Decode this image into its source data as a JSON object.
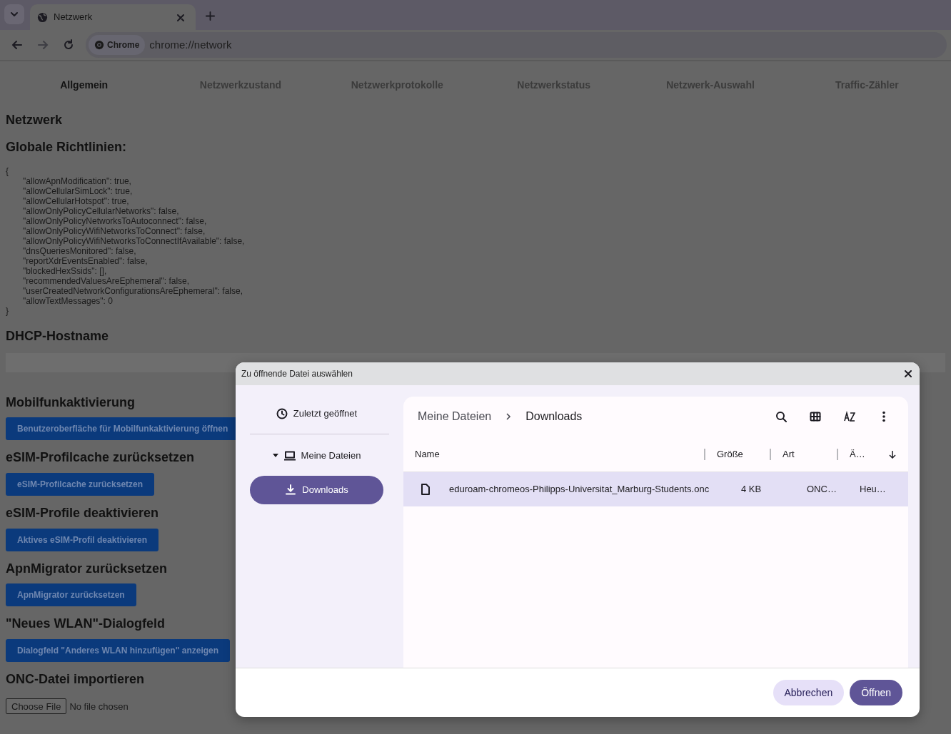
{
  "browser": {
    "tabs": [
      {
        "title": "Netzwerk",
        "selected": true
      }
    ],
    "site_chip": "Chrome",
    "url": "chrome://network"
  },
  "page_tabs": [
    {
      "label": "Allgemein",
      "selected": true
    },
    {
      "label": "Netzwerkzustand",
      "selected": false
    },
    {
      "label": "Netzwerkprotokolle",
      "selected": false
    },
    {
      "label": "Netzwerkstatus",
      "selected": false
    },
    {
      "label": "Netzwerk-Auswahl",
      "selected": false
    },
    {
      "label": "Traffic-Zähler",
      "selected": false
    }
  ],
  "title": "Netzwerk",
  "policies": {
    "heading": "Globale Richtlinien:",
    "open": "{",
    "lines": [
      "\"allowApnModification\": true,",
      "\"allowCellularSimLock\": true,",
      "\"allowCellularHotspot\": true,",
      "\"allowOnlyPolicyCellularNetworks\": false,",
      "\"allowOnlyPolicyNetworksToAutoconnect\": false,",
      "\"allowOnlyPolicyWifiNetworksToConnect\": false,",
      "\"allowOnlyPolicyWifiNetworksToConnectIfAvailable\": false,",
      "\"dnsQueriesMonitored\": false,",
      "\"reportXdrEventsEnabled\": false,",
      "\"blockedHexSsids\": [],",
      "\"recommendedValuesAreEphemeral\": false,",
      "\"userCreatedNetworkConfigurationsAreEphemeral\": false,",
      "\"allowTextMessages\": 0"
    ],
    "close": "}"
  },
  "sections": [
    {
      "heading": "DHCP-Hostname",
      "kind": "field"
    },
    {
      "heading": "Mobilfunkaktivierung",
      "kind": "button",
      "button": "Benutzeroberfläche für Mobilfunkaktivierung öffnen"
    },
    {
      "heading": "eSIM-Profilcache zurücksetzen",
      "kind": "button",
      "button": "eSIM-Profilcache zurücksetzen"
    },
    {
      "heading": "eSIM-Profile deaktivieren",
      "kind": "button",
      "button": "Aktives eSIM-Profil deaktivieren"
    },
    {
      "heading": "ApnMigrator zurücksetzen",
      "kind": "button",
      "button": "ApnMigrator zurücksetzen"
    },
    {
      "heading": "\"Neues WLAN\"-Dialogfeld",
      "kind": "button",
      "button": "Dialogfeld \"Anderes WLAN hinzufügen\" anzeigen"
    },
    {
      "heading": "ONC-Datei importieren",
      "kind": "file",
      "button": "Choose File",
      "status": "No file chosen"
    }
  ],
  "dialog": {
    "title": "Zu öffnende Datei auswählen",
    "sidebar": [
      {
        "label": "Zuletzt geöffnet",
        "kind": "recent",
        "selected": false
      },
      {
        "label": "Meine Dateien",
        "kind": "computer",
        "selected": false,
        "expanded": true,
        "children": [
          {
            "label": "Downloads",
            "kind": "download",
            "selected": true
          }
        ]
      }
    ],
    "breadcrumb": [
      "Meine Dateien",
      "Downloads"
    ],
    "columns": [
      "Name",
      "Größe",
      "Art",
      "Ä…"
    ],
    "rows": [
      {
        "name": "eduroam-chromeos-Philipps-Universitat_Marburg-Students.onc",
        "size": "4 KB",
        "type": "ONC…",
        "modified": "Heu…",
        "selected": true
      }
    ],
    "buttons": [
      {
        "label": "Abbrechen",
        "kind": "secondary"
      },
      {
        "label": "Öffnen",
        "kind": "primary"
      }
    ]
  }
}
